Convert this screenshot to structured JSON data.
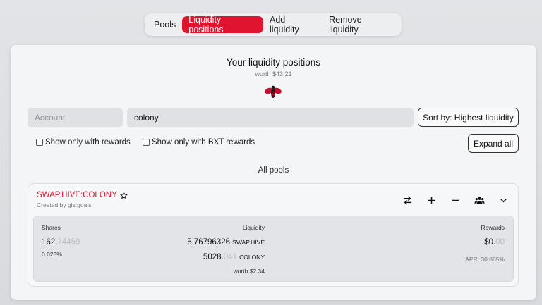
{
  "tabs": [
    {
      "label": "Pools",
      "active": false
    },
    {
      "label": "Liquidity positions",
      "active": true
    },
    {
      "label": "Add liquidity",
      "active": false
    },
    {
      "label": "Remove liquidity",
      "active": false
    }
  ],
  "accent_color": "#e0142f",
  "header": {
    "title": "Your liquidity positions",
    "worth": "worth $43.21",
    "logo": "bee-logo"
  },
  "filters": {
    "account_placeholder": "Account",
    "account_value": "",
    "search_value": "colony",
    "sort_label": "Sort by: Highest liquidity",
    "check_rewards": "Show only with rewards",
    "check_bxt": "Show only with BXT rewards",
    "expand_label": "Expand all"
  },
  "section_title": "All pools",
  "pool": {
    "pair": "SWAP.HIVE:COLONY",
    "created_by": "Created by gls.goals",
    "actions": [
      "swap-icon",
      "plus-icon",
      "minus-icon",
      "users-icon",
      "chevron-down-icon"
    ],
    "shares_label": "Shares",
    "shares_main": "162.",
    "shares_faint": "74459",
    "shares_pct": "0.023%",
    "liquidity_label": "Liquidity",
    "liq1_amount": "5.76796326",
    "liq1_symbol": "SWAP.HIVE",
    "liq2_main": "5028.",
    "liq2_faint": "041",
    "liq2_symbol": "COLONY",
    "liq_worth": "worth $2.34",
    "rewards_label": "Rewards",
    "rewards_main": "$0.",
    "rewards_faint": "00",
    "apr": "APR: 30.865%"
  }
}
